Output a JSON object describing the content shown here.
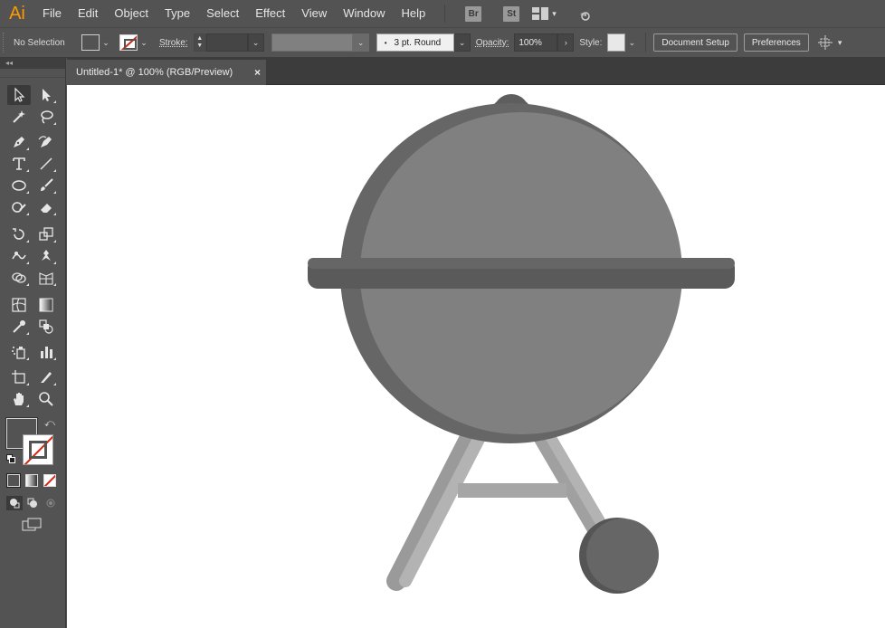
{
  "app": {
    "logo": "Ai",
    "menu": [
      "File",
      "Edit",
      "Object",
      "Type",
      "Select",
      "Effect",
      "View",
      "Window",
      "Help"
    ],
    "bridge_badge": "Br",
    "stock_badge": "St"
  },
  "control_bar": {
    "selection_label": "No Selection",
    "stroke_label": "Stroke:",
    "brush_value": "3 pt. Round",
    "opacity_label": "Opacity:",
    "opacity_value": "100%",
    "style_label": "Style:",
    "document_setup": "Document Setup",
    "preferences": "Preferences"
  },
  "toolbox": {
    "collapse": "◂◂"
  },
  "document": {
    "tab_title": "Untitled-1* @ 100% (RGB/Preview)",
    "close_glyph": "×"
  },
  "colors": {
    "ui_bg": "#535353",
    "canvas_bg": "#ffffff",
    "logo": "#ff9a00",
    "grill_body": "#808080",
    "grill_shadow": "#666666",
    "grill_band": "#5a5a5a",
    "leg_light": "#b3b3b3",
    "leg_dark": "#9a9a9a",
    "wheel": "#666666",
    "wheel_shadow": "#555555"
  },
  "icons": [
    "selection-tool-icon",
    "direct-selection-tool-icon",
    "magic-wand-icon",
    "lasso-icon",
    "pen-icon",
    "curvature-icon",
    "type-icon",
    "line-icon",
    "ellipse-icon",
    "paintbrush-icon",
    "shaper-icon",
    "eraser-icon",
    "rotate-icon",
    "scale-icon",
    "warp-icon",
    "puppet-warp-icon",
    "shape-builder-icon",
    "perspective-grid-icon",
    "mesh-icon",
    "gradient-icon",
    "eyedropper-icon",
    "blend-icon",
    "symbol-sprayer-icon",
    "column-graph-icon",
    "artboard-icon",
    "slice-icon",
    "hand-icon",
    "zoom-icon"
  ]
}
